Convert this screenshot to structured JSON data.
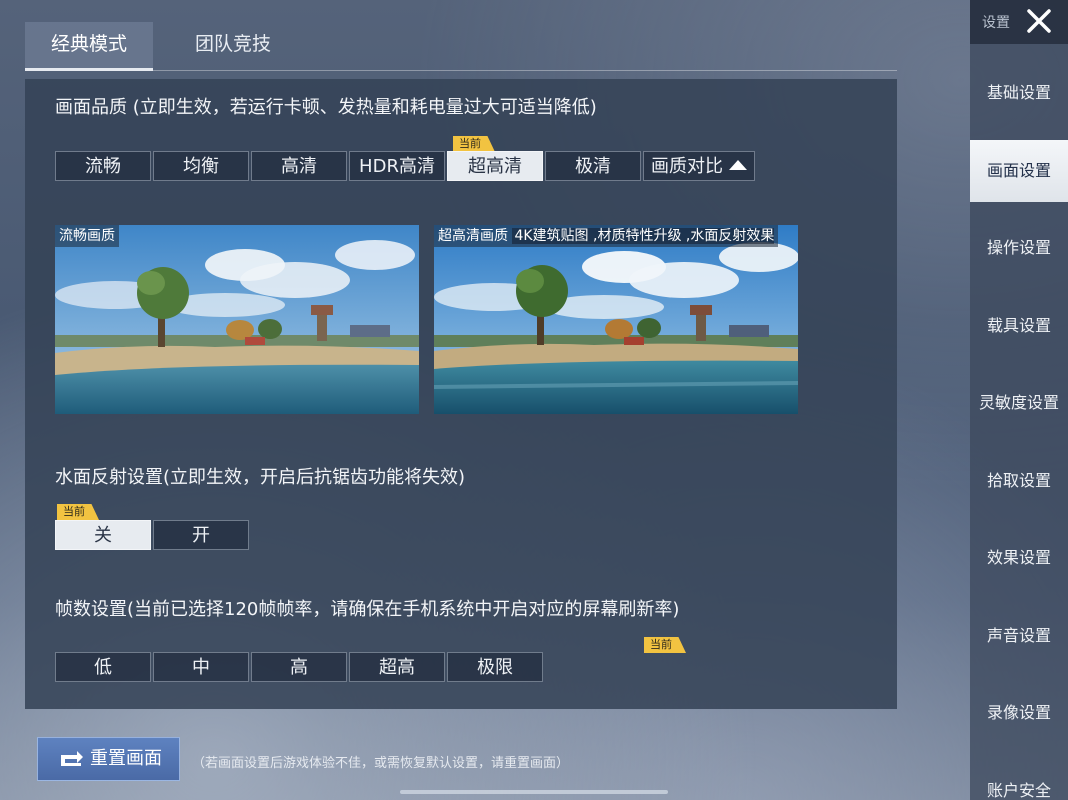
{
  "tabs": [
    {
      "label": "经典模式",
      "active": true
    },
    {
      "label": "团队竞技",
      "active": false
    }
  ],
  "sidebar": {
    "title": "设置",
    "items": [
      {
        "label": "基础设置",
        "active": false
      },
      {
        "label": "画面设置",
        "active": true
      },
      {
        "label": "操作设置",
        "active": false
      },
      {
        "label": "载具设置",
        "active": false
      },
      {
        "label": "灵敏度设置",
        "active": false
      },
      {
        "label": "拾取设置",
        "active": false
      },
      {
        "label": "效果设置",
        "active": false
      },
      {
        "label": "声音设置",
        "active": false
      },
      {
        "label": "录像设置",
        "active": false
      },
      {
        "label": "账户安全",
        "active": false
      }
    ]
  },
  "quality": {
    "title": "画面品质 (立即生效，若运行卡顿、发热量和耗电量过大可适当降低)",
    "badge": "当前",
    "options": [
      "流畅",
      "均衡",
      "高清",
      "HDR高清",
      "超高清",
      "极清"
    ],
    "selected": "超高清",
    "compare_label": "画质对比"
  },
  "previews": {
    "left_label": "流畅画质",
    "right_label": "超高清画质",
    "right_features": "4K建筑贴图 ,材质特性升级 ,水面反射效果"
  },
  "water": {
    "title": "水面反射设置(立即生效，开启后抗锯齿功能将失效)",
    "badge": "当前",
    "options": [
      "关",
      "开"
    ],
    "selected": "关"
  },
  "fps": {
    "title": "帧数设置(当前已选择120帧帧率，请确保在手机系统中开启对应的屏幕刷新率)",
    "badge": "当前",
    "options": [
      "低",
      "中",
      "高",
      "超高",
      "极限"
    ]
  },
  "reset": {
    "label": "重置画面",
    "note": "（若画面设置后游戏体验不佳，或需恢复默认设置，请重置画面）"
  },
  "colors": {
    "badge": "#f2c341",
    "accent_button": "#4a6aa6",
    "selected_option": "#e7ebf0"
  }
}
